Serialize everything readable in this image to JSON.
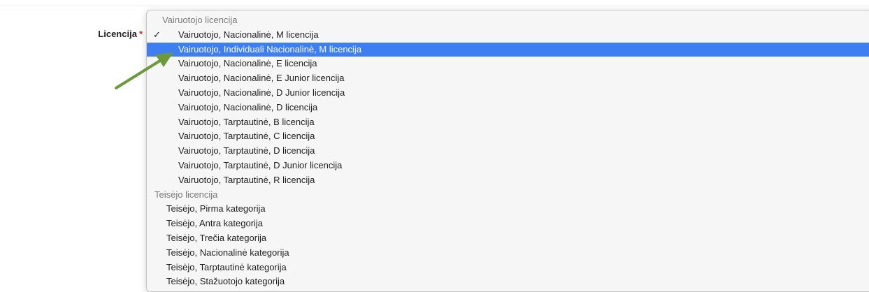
{
  "field": {
    "label": "Licencija",
    "required_marker": "*"
  },
  "dropdown": {
    "selected_value": "Vairuotojo, Nacionalinė, M licencija",
    "highlighted_value": "Vairuotojo, Individuali Nacionalinė, M licencija",
    "groups": [
      {
        "label": "Vairuotojo licencija",
        "options": [
          "Vairuotojo, Nacionalinė, M licencija",
          "Vairuotojo, Individuali Nacionalinė, M licencija",
          "Vairuotojo, Nacionalinė, E licencija",
          "Vairuotojo, Nacionalinė, E Junior licencija",
          "Vairuotojo, Nacionalinė, D Junior licencija",
          "Vairuotojo, Nacionalinė, D licencija",
          "Vairuotojo, Tarptautinė, B licencija",
          "Vairuotojo, Tarptautinė, C licencija",
          "Vairuotojo, Tarptautinė, D licencija",
          "Vairuotojo, Tarptautinė, D Junior licencija",
          "Vairuotojo, Tarptautinė, R licencija"
        ]
      },
      {
        "label": "Teisėjo licencija",
        "options": [
          "Teisėjo, Pirma kategorija",
          "Teisėjo, Antra kategorija",
          "Teisėjo, Trečia kategorija",
          "Teisėjo, Nacionalinė kategorija",
          "Teisėjo, Tarptautinė kategorija",
          "Teisėjo, Stažuotojo kategorija"
        ]
      }
    ],
    "checkmark_glyph": "✓"
  },
  "annotation": {
    "arrow_color": "#6a9a3a",
    "highlight_color": "#3d7ff3"
  }
}
